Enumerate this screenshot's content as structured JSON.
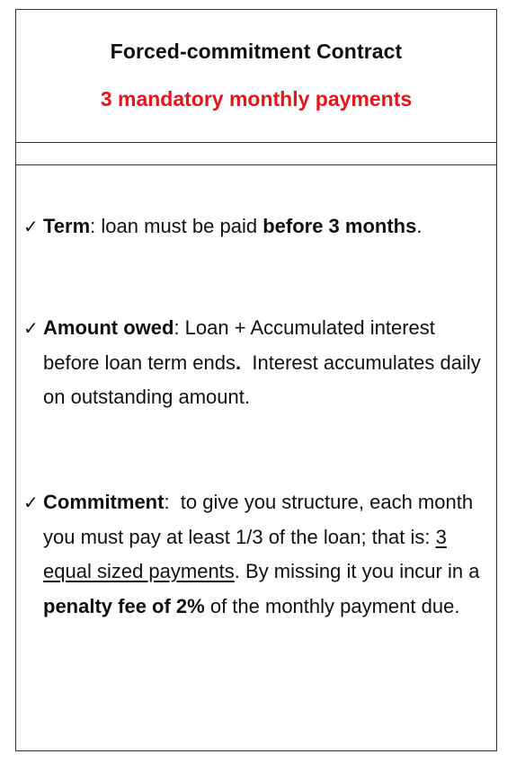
{
  "header": {
    "title": "Forced-commitment Contract",
    "subtitle": "3 mandatory monthly payments",
    "subtitle_color": "#e3161b"
  },
  "items": [
    {
      "icon": "checkmark-icon",
      "glyph": "✓",
      "label": "Term",
      "sep": ": ",
      "text_1": "loan must be paid ",
      "bold_1": "before 3 months",
      "text_2": "."
    },
    {
      "icon": "checkmark-icon",
      "glyph": "✓",
      "label": "Amount owed",
      "sep": ": ",
      "text_1": "Loan + Accumulated interest before loan term ends",
      "bold_1": ".",
      "text_2": "  Interest accumulates daily on outstanding amount."
    },
    {
      "icon": "checkmark-icon",
      "glyph": "✓",
      "label": "Commitment",
      "sep": ":  ",
      "text_1": "to give you structure, each month you must pay at least 1/3 of the loan; that is: ",
      "underline_1": "3 equal sized payments",
      "text_2": ". By missing it you incur in a ",
      "bold_1": "penalty fee of 2%",
      "text_3": " of the monthly payment due."
    }
  ]
}
